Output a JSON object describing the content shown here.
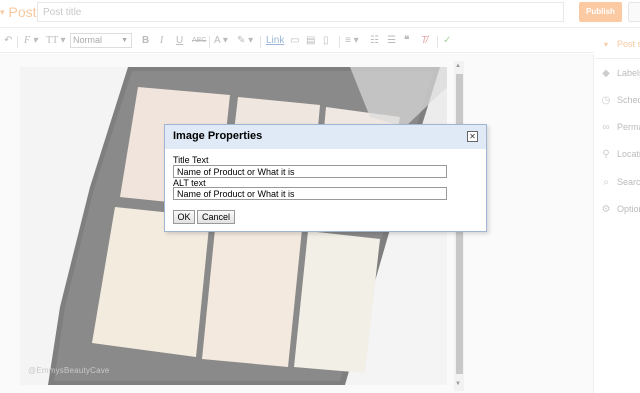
{
  "header": {
    "post_label": "Post",
    "title_placeholder": "Post title",
    "publish_label": "Publish"
  },
  "toolbar": {
    "undo_icon": "undo-icon",
    "font_label": "F",
    "font_size_label": "TT",
    "format_value": "Normal",
    "bold_label": "B",
    "italic_label": "I",
    "underline_label": "U",
    "strike_label": "ABC",
    "text_color_label": "A",
    "link_label": "Link"
  },
  "editor": {
    "watermark": "@EmmysBeautyCave"
  },
  "right_panel": {
    "heading": "Post se",
    "items": [
      {
        "label": "Labels",
        "icon": "tag-icon"
      },
      {
        "label": "Sched",
        "icon": "clock-icon"
      },
      {
        "label": "Perma",
        "icon": "link-icon"
      },
      {
        "label": "Locati",
        "icon": "location-icon"
      },
      {
        "label": "Search",
        "icon": "search-icon"
      },
      {
        "label": "Option",
        "icon": "gear-icon"
      }
    ]
  },
  "dialog": {
    "title": "Image Properties",
    "title_text_label": "Title Text",
    "title_text_value": "Name of Product or What it is",
    "alt_text_label": "ALT text",
    "alt_text_value": "Name of Product or What it is",
    "ok_label": "OK",
    "cancel_label": "Cancel"
  },
  "colors": {
    "accent": "#f9a66c",
    "dialog_header": "#dfeaf6",
    "dialog_border": "#9fb5d1"
  }
}
